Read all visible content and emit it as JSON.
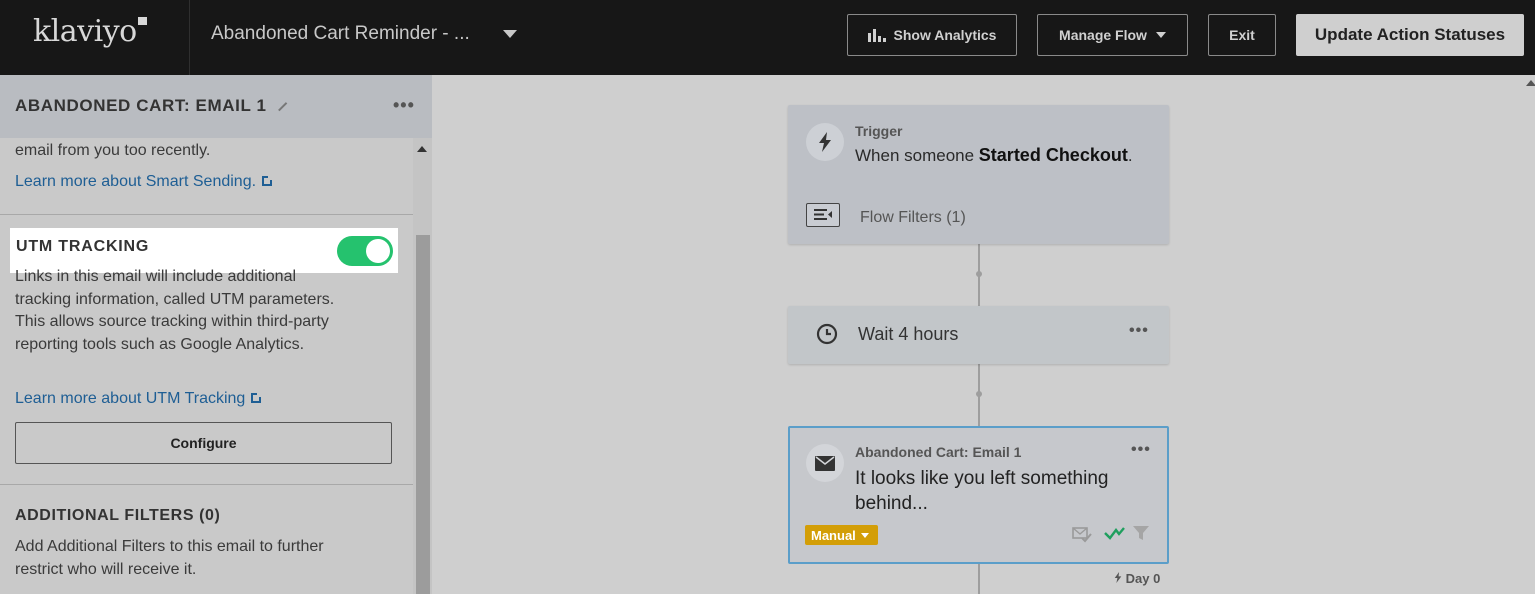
{
  "header": {
    "logo": "klaviyo",
    "flow_title": "Abandoned Cart Reminder - ...",
    "show_analytics": "Show Analytics",
    "manage_flow": "Manage Flow",
    "exit": "Exit",
    "update_action_statuses": "Update Action Statuses"
  },
  "sidebar": {
    "title": "ABANDONED CART: EMAIL 1",
    "more": "•••",
    "smart_sending_text": "email from you too recently.",
    "smart_sending_link": "Learn more about Smart Sending.",
    "utm_title": "UTM TRACKING",
    "utm_enabled": true,
    "utm_description": "Links in this email will include additional tracking information, called UTM parameters. This allows source tracking within third-party reporting tools such as Google Analytics.",
    "utm_link": "Learn more about UTM Tracking",
    "configure": "Configure",
    "additional_filters_title": "ADDITIONAL FILTERS (0)",
    "additional_filters_text": "Add Additional Filters to this email to further restrict who will receive it."
  },
  "canvas": {
    "trigger_label": "Trigger",
    "trigger_text_prefix": "When someone ",
    "trigger_event": "Started Checkout",
    "trigger_text_suffix": ".",
    "flow_filters": "Flow Filters (1)",
    "wait_text": "Wait 4 hours",
    "more": "•••",
    "email_label": "Abandoned Cart: Email 1",
    "email_subject": "It looks like you left something behind...",
    "status_badge": "Manual",
    "day_label": "Day 0"
  },
  "colors": {
    "toggle_on": "#25c26e",
    "link": "#1e5e94",
    "selected_border": "#5b9ec9",
    "manual_badge": "#d39e07"
  }
}
